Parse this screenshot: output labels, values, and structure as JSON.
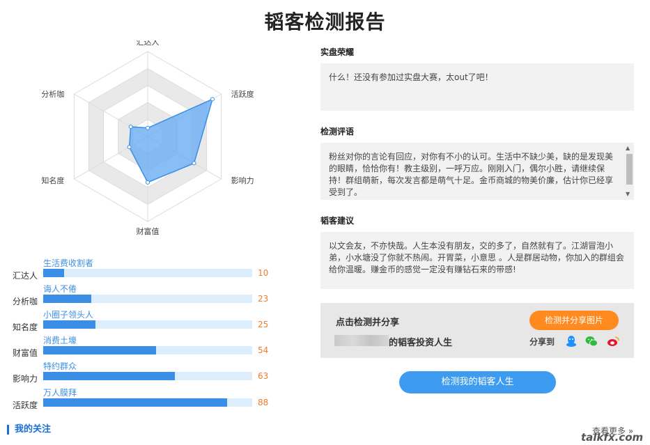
{
  "page_title": "韬客检测报告",
  "radar": {
    "labels": [
      "汇达人",
      "活跃度",
      "影响力",
      "财富值",
      "知名度",
      "分析咖"
    ],
    "values": [
      10,
      88,
      63,
      54,
      25,
      23
    ],
    "max": 100,
    "fill_color": "#6aaef2",
    "stroke_color": "#3a8ee6"
  },
  "bars": [
    {
      "dimension": "汇达人",
      "title": "生活费收割者",
      "value": 10,
      "value_text": "10"
    },
    {
      "dimension": "分析咖",
      "title": "诲人不倦",
      "value": 23,
      "value_text": "23"
    },
    {
      "dimension": "知名度",
      "title": "小圈子领头人",
      "value": 25,
      "value_text": "25"
    },
    {
      "dimension": "财富值",
      "title": "消费土壕",
      "value": 54,
      "value_text": "54"
    },
    {
      "dimension": "影响力",
      "title": "特约群众",
      "value": 63,
      "value_text": "63"
    },
    {
      "dimension": "活跃度",
      "title": "万人膜拜",
      "value": 88,
      "value_text": "88"
    }
  ],
  "my_follow": "我的关注",
  "see_more": "查看更多 »",
  "watermark": "talkfx.com",
  "sections": {
    "honor": {
      "title": "实盘荣耀",
      "text": "什么！还没有参加过实盘大赛，太out了吧！"
    },
    "review": {
      "title": "检测评语",
      "text": "粉丝对你的言论有回应，对你有不小的认可。生活中不缺少美，缺的是发现美的眼睛，恰恰你有！教主级别，一呼万应。刚刚入门，偶尔小胜，请继续保持！群组萌新，每次发言都是萌气十足。金币商城的物美价廉，估计你已经享受到了。"
    },
    "advice": {
      "title": "韬客建议",
      "text": "以文会友，不亦快哉。人生本没有朋友，交的多了，自然就有了。江湖冒泡小弟，小水塘没了你就不热闹。开胃菜，小意思 。人是群居动物，你加入的群组会给你温暖。赚金币的感觉一定没有赚钻石来的带感!"
    }
  },
  "share": {
    "prompt": "点击检测并分享",
    "subtitle": "的韬客投资人生",
    "button_label": "检测并分享图片",
    "share_to": "分享到",
    "icons": [
      "qq-icon",
      "wechat-icon",
      "weibo-icon"
    ]
  },
  "main_button": "检测我的韬客人生"
}
